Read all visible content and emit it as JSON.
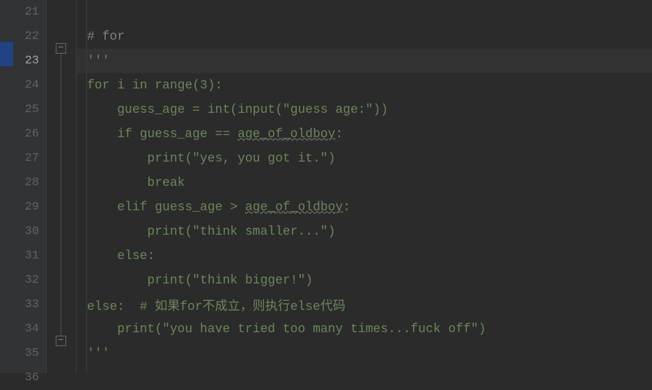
{
  "gutter": {
    "lines": [
      "21",
      "22",
      "23",
      "24",
      "25",
      "26",
      "27",
      "28",
      "29",
      "30",
      "31",
      "32",
      "33",
      "34",
      "35",
      "36"
    ],
    "active_index": 2
  },
  "fold": {
    "minus": "−"
  },
  "code": {
    "l21": "",
    "l22_pre": "",
    "l22_comment": "# for",
    "l23_pre": "",
    "l23_str": "'''",
    "l24_pre": "",
    "l24_kw1": "for",
    "l24_mid": " i ",
    "l24_kw2": "in",
    "l24_func": "range",
    "l24_tail": "(3):",
    "l25_pre": "    ",
    "l25_id": "guess_age = ",
    "l25_f1": "int",
    "l25_p1": "(",
    "l25_f2": "input",
    "l25_p2": "(",
    "l25_s": "\"guess age:\"",
    "l25_p3": "))",
    "l26_pre": "    ",
    "l26_kw": "if ",
    "l26_id1": "guess_age == ",
    "l26_wav": "age_of_oldboy",
    "l26_tail": ":",
    "l27_pre": "        ",
    "l27_f": "print",
    "l27_p1": "(",
    "l27_s": "\"yes, you got it.\"",
    "l27_p2": ")",
    "l28_pre": "        ",
    "l28_kw": "break",
    "l29_pre": "    ",
    "l29_kw": "elif ",
    "l29_id1": "guess_age > ",
    "l29_wav": "age_of_oldboy",
    "l29_tail": ":",
    "l30_pre": "        ",
    "l30_f": "print",
    "l30_p1": "(",
    "l30_s": "\"think smaller...\"",
    "l30_p2": ")",
    "l31_pre": "    ",
    "l31_kw": "else",
    "l31_tail": ":",
    "l32_pre": "        ",
    "l32_f": "print",
    "l32_p1": "(",
    "l32_s": "\"think bigger!\"",
    "l32_p2": ")",
    "l33_pre": "",
    "l33_kw": "else",
    "l33_mid": ":  ",
    "l33_comment": "# 如果for不成立，则执行else代码",
    "l34_pre": "    ",
    "l34_f": "print",
    "l34_p1": "(",
    "l34_s": "\"you have tried too many times...fuck off\"",
    "l34_p2": ")",
    "l35_pre": "",
    "l35_str": "'''",
    "l36": ""
  }
}
